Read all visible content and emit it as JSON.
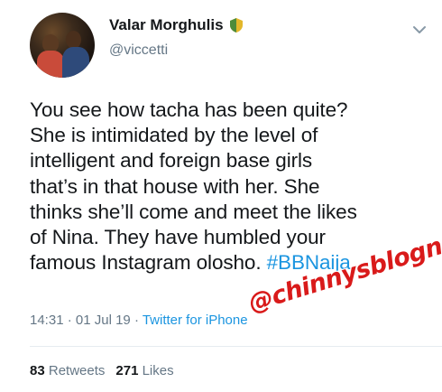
{
  "user": {
    "display_name": "Valar Morghulis",
    "handle": "@viccetti",
    "avatar_icon": "profile-photo"
  },
  "tweet": {
    "lines": [
      "You see how tacha has been quite?",
      "She is intimidated by the level of",
      "intelligent and foreign base girls",
      "that’s in that house with her. She",
      "thinks she’ll come and meet the likes",
      "of Nina. They have humbled your"
    ],
    "last_line_text": "famous Instagram olosho. ",
    "hashtag": "#BBNaija"
  },
  "meta": {
    "time": "14:31",
    "separator": " · ",
    "date": "01 Jul 19",
    "source": "Twitter for iPhone"
  },
  "stats": {
    "retweets_count": "83",
    "retweets_label": "Retweets",
    "likes_count": "271",
    "likes_label": "Likes"
  },
  "watermark": {
    "text": "@chinnysblogng"
  },
  "colors": {
    "link": "#1b95e0",
    "secondary_text": "#657786",
    "watermark": "#d91a1a",
    "badge": "#e3b72a"
  }
}
